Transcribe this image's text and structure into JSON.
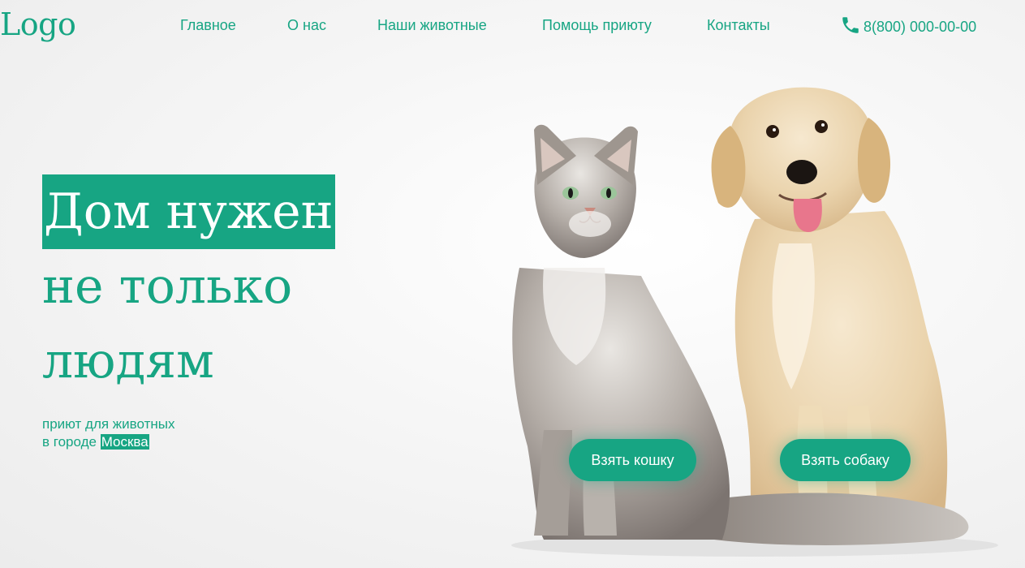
{
  "header": {
    "logo": "Logo",
    "nav": [
      {
        "label": "Главное"
      },
      {
        "label": "О нас"
      },
      {
        "label": "Наши животные"
      },
      {
        "label": "Помощь приюту"
      },
      {
        "label": "Контакты"
      }
    ],
    "phone": "8(800) 000-00-00",
    "phone_icon": "phone-icon"
  },
  "hero": {
    "line1": "Дом нужен",
    "line2": "не только",
    "line3": "людям",
    "subtitle_line1": "приют для животных",
    "subtitle_prefix": "в городе",
    "city": "Москва"
  },
  "image": {
    "subject": "cat-and-dog-photo"
  },
  "buttons": {
    "take_cat": "Взять кошку",
    "take_dog": "Взять собаку"
  },
  "colors": {
    "accent": "#17a583",
    "background": "#f3f3f3",
    "button_text": "#ffffff"
  }
}
